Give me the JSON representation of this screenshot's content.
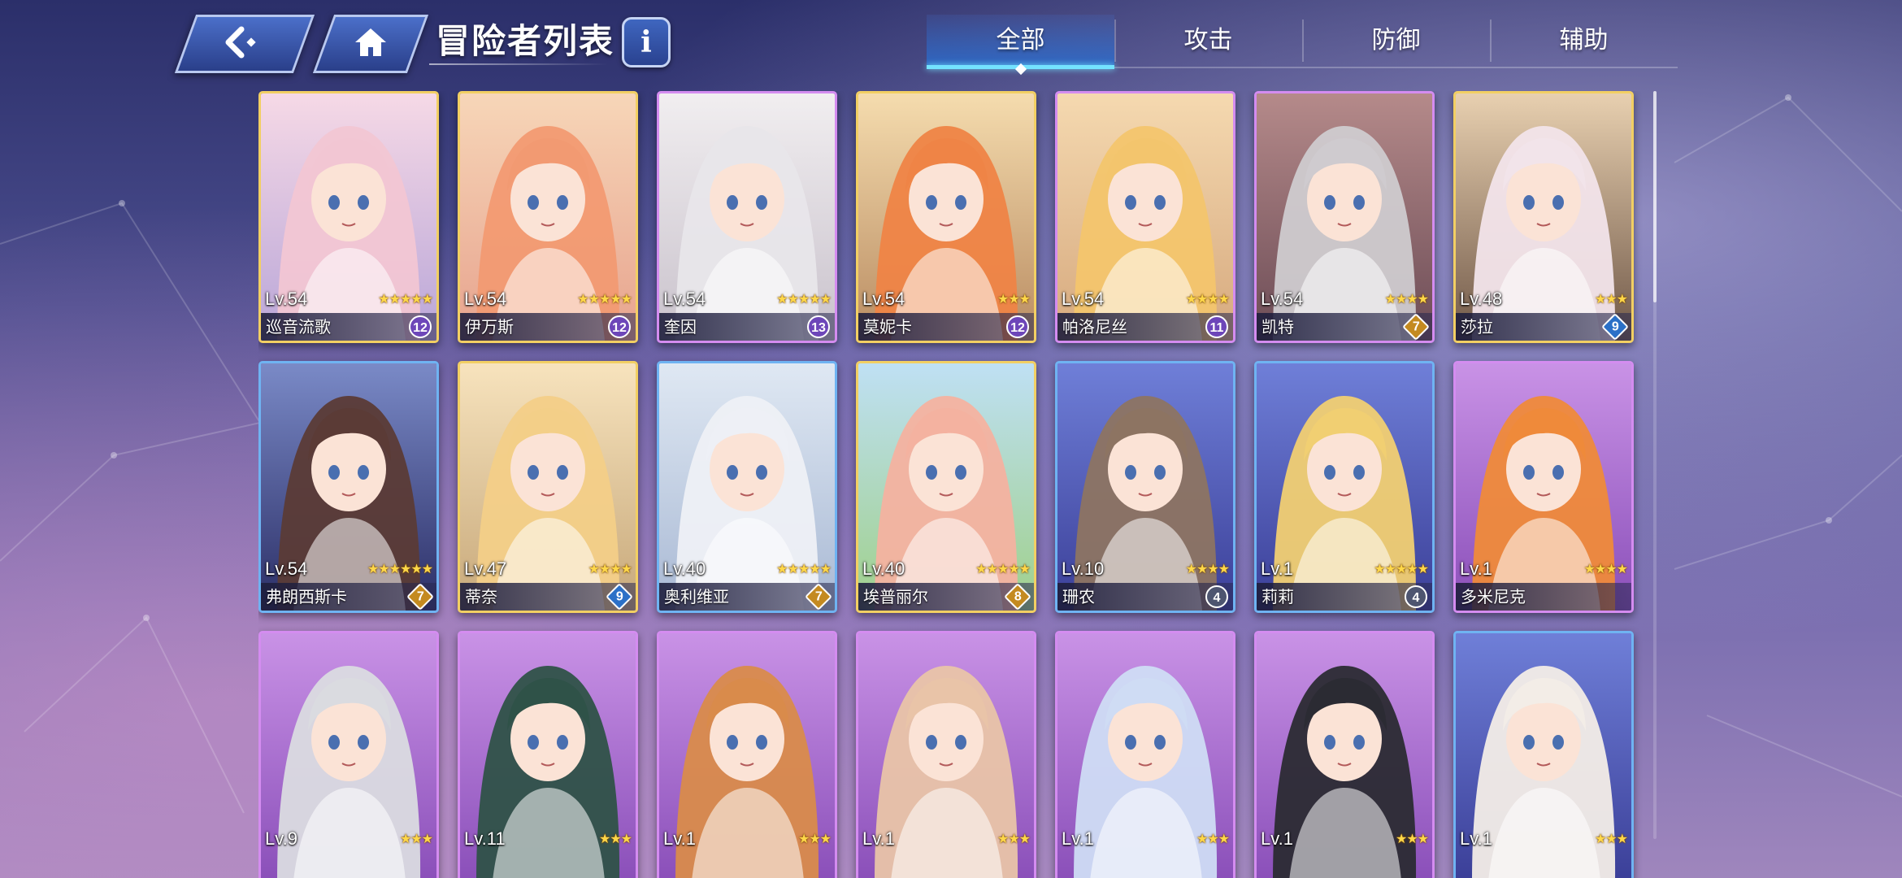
{
  "header": {
    "title": "冒险者列表",
    "back_icon": "back-arrow-icon",
    "home_icon": "home-icon",
    "info_label": "i"
  },
  "tabs": [
    {
      "label": "全部",
      "active": true
    },
    {
      "label": "攻击",
      "active": false
    },
    {
      "label": "防御",
      "active": false
    },
    {
      "label": "辅助",
      "active": false
    }
  ],
  "colors": {
    "accent_tab": "#74e3ff",
    "frame_gold": "#f2cf63",
    "frame_purple": "#d48cf0",
    "frame_blue": "#6fb3f2",
    "star": "#ffd749"
  },
  "adventurers": [
    {
      "level": "Lv.54",
      "stars": 5,
      "name": "巡音流歌",
      "badge": "12",
      "badge_style": "purple",
      "frame": "gold",
      "hair": "#f2c6d3",
      "bg": [
        "#f6d9e6",
        "#b9a6d8"
      ]
    },
    {
      "level": "Lv.54",
      "stars": 5,
      "name": "伊万斯",
      "badge": "12",
      "badge_style": "purple",
      "frame": "gold",
      "hair": "#f29a72",
      "bg": [
        "#f7d6b8",
        "#e7a38e"
      ]
    },
    {
      "level": "Lv.54",
      "stars": 5,
      "name": "奎因",
      "badge": "13",
      "badge_style": "purple",
      "frame": "purple",
      "hair": "#e8e6ea",
      "bg": [
        "#f1eef0",
        "#c9c2cc"
      ]
    },
    {
      "level": "Lv.54",
      "stars": 3,
      "name": "莫妮卡",
      "badge": "12",
      "badge_style": "purple",
      "frame": "gold",
      "hair": "#ef8446",
      "bg": [
        "#f5dcae",
        "#b98c62"
      ]
    },
    {
      "level": "Lv.54",
      "stars": 4,
      "name": "帕洛尼丝",
      "badge": "11",
      "badge_style": "purple",
      "frame": "purple",
      "hair": "#f3c56d",
      "bg": [
        "#f5d9b0",
        "#d6a97e"
      ]
    },
    {
      "level": "Lv.54",
      "stars": 4,
      "name": "凯特",
      "badge": "7",
      "badge_style": "gold",
      "frame": "purple",
      "hair": "#cfcbcf",
      "bg": [
        "#b58a8a",
        "#6c4c56"
      ]
    },
    {
      "level": "Lv.48",
      "stars": 3,
      "name": "莎拉",
      "badge": "9",
      "badge_style": "blue",
      "frame": "gold",
      "hair": "#f2e4ea",
      "bg": [
        "#e8d0b0",
        "#705848"
      ]
    },
    {
      "level": "Lv.54",
      "stars": 6,
      "name": "弗朗西斯卡",
      "badge": "7",
      "badge_style": "gold",
      "frame": "blue",
      "hair": "#5b3b36",
      "bg": [
        "#7a8ac7",
        "#2b2e66"
      ]
    },
    {
      "level": "Lv.47",
      "stars": 4,
      "name": "蒂奈",
      "badge": "9",
      "badge_style": "blue",
      "frame": "gold",
      "hair": "#f3cf88",
      "bg": [
        "#f7e3bd",
        "#c7a87a"
      ]
    },
    {
      "level": "Lv.40",
      "stars": 5,
      "name": "奥利维亚",
      "badge": "7",
      "badge_style": "gold",
      "frame": "blue",
      "hair": "#eef0f6",
      "bg": [
        "#dfe8f3",
        "#a9b9d4"
      ]
    },
    {
      "level": "Lv.40",
      "stars": 5,
      "name": "埃普丽尔",
      "badge": "8",
      "badge_style": "gold",
      "frame": "gold",
      "hair": "#f4b2a0",
      "bg": [
        "#bfe0f4",
        "#9fd08a"
      ]
    },
    {
      "level": "Lv.10",
      "stars": 4,
      "name": "珊农",
      "badge": "4",
      "badge_style": "gray",
      "frame": "blue",
      "hair": "#8d7462",
      "bg": [
        "#6f7fd8",
        "#3b3f98"
      ]
    },
    {
      "level": "Lv.1",
      "stars": 5,
      "name": "莉莉",
      "badge": "4",
      "badge_style": "gray",
      "frame": "blue",
      "hair": "#f1cf72",
      "bg": [
        "#6f7fd8",
        "#3b3f98"
      ]
    },
    {
      "level": "Lv.1",
      "stars": 4,
      "name": "多米尼克",
      "badge": "",
      "badge_style": "none",
      "frame": "purple",
      "hair": "#ef8a3a",
      "bg": [
        "#c992e6",
        "#8a4fb9"
      ]
    },
    {
      "level": "Lv.9",
      "stars": 3,
      "name": "",
      "badge": "",
      "badge_style": "none",
      "frame": "purple",
      "hair": "#dadbe0",
      "bg": [
        "#c992e6",
        "#8a4fb9"
      ]
    },
    {
      "level": "Lv.11",
      "stars": 3,
      "name": "",
      "badge": "",
      "badge_style": "none",
      "frame": "purple",
      "hair": "#2f5248",
      "bg": [
        "#c992e6",
        "#8a4fb9"
      ]
    },
    {
      "level": "Lv.1",
      "stars": 3,
      "name": "",
      "badge": "",
      "badge_style": "none",
      "frame": "purple",
      "hair": "#d98b4b",
      "bg": [
        "#c992e6",
        "#8a4fb9"
      ]
    },
    {
      "level": "Lv.1",
      "stars": 3,
      "name": "",
      "badge": "",
      "badge_style": "none",
      "frame": "purple",
      "hair": "#e9c4a8",
      "bg": [
        "#c992e6",
        "#8a4fb9"
      ]
    },
    {
      "level": "Lv.1",
      "stars": 3,
      "name": "",
      "badge": "",
      "badge_style": "none",
      "frame": "purple",
      "hair": "#cfdcf4",
      "bg": [
        "#c992e6",
        "#8a4fb9"
      ]
    },
    {
      "level": "Lv.1",
      "stars": 3,
      "name": "",
      "badge": "",
      "badge_style": "none",
      "frame": "purple",
      "hair": "#2b2b33",
      "bg": [
        "#c992e6",
        "#8a4fb9"
      ]
    },
    {
      "level": "Lv.1",
      "stars": 3,
      "name": "",
      "badge": "",
      "badge_style": "none",
      "frame": "blue",
      "hair": "#f3ede7",
      "bg": [
        "#6f7fd8",
        "#3b3f98"
      ]
    }
  ]
}
